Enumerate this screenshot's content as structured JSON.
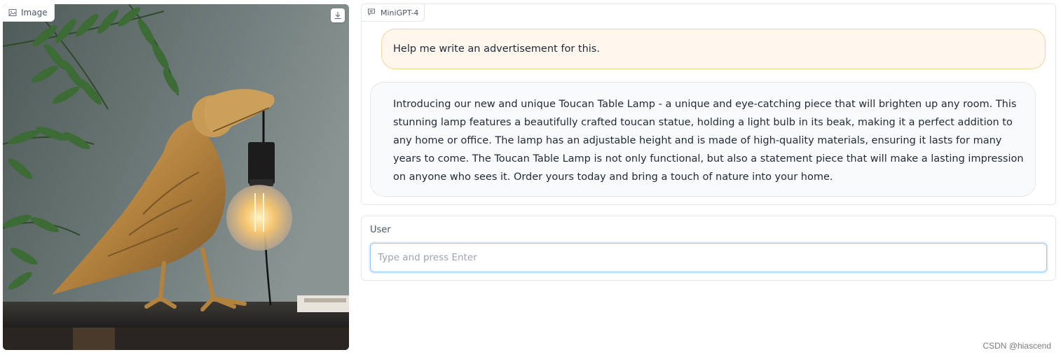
{
  "image_panel": {
    "label": "Image",
    "icons": {
      "label": "image-icon",
      "download": "download-icon"
    }
  },
  "chat": {
    "label": "MiniGPT-4",
    "icon": "chat-icon",
    "messages": [
      {
        "role": "user",
        "text": "Help me write an advertisement for this."
      },
      {
        "role": "bot",
        "text": "Introducing our new and unique Toucan Table Lamp - a unique and eye-catching piece that will brighten up any room. This stunning lamp features a beautifully crafted toucan statue, holding a light bulb in its beak, making it a perfect addition to any home or office. The lamp has an adjustable height and is made of high-quality materials, ensuring it lasts for many years to come. The Toucan Table Lamp is not only functional, but also a statement piece that will make a lasting impression on anyone who sees it. Order yours today and bring a touch of nature into your home."
      }
    ]
  },
  "user_input": {
    "label": "User",
    "placeholder": "Type and press Enter",
    "value": ""
  },
  "watermark": "CSDN @hiascend",
  "colors": {
    "user_bubble_bg": "#fff7ed",
    "user_bubble_border": "#f5d49a",
    "bot_bubble_bg": "#f9fafb",
    "input_focus_border": "#93c5fd"
  }
}
